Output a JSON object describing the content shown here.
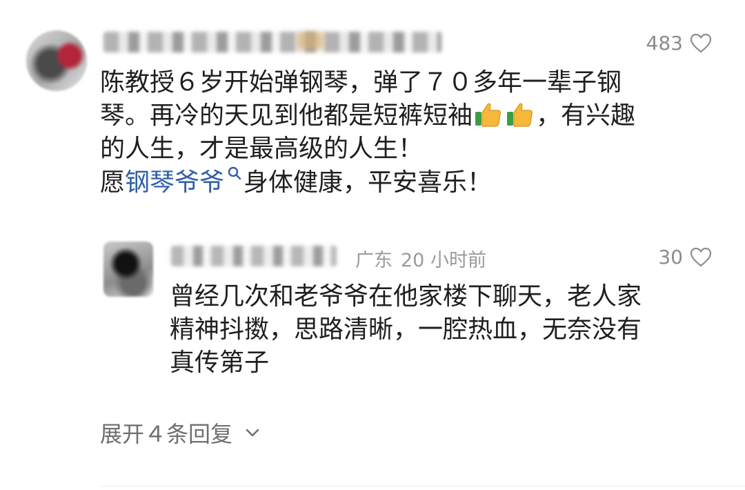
{
  "comment": {
    "like_count": "483",
    "line1": "陈教授６岁开始弹钢琴，弹了７０多年一辈子钢",
    "line2_a": "琴。再冷的天见到他都是短裤短袖",
    "line2_b": "，有兴趣",
    "line3": "的人生，才是最高级的人生！",
    "line4_a": "愿",
    "line4_link": "钢琴爷爷",
    "line4_b": "身体健康，平安喜乐！"
  },
  "reply": {
    "region": "广东",
    "time": "20 小时前",
    "like_count": "30",
    "line1": "曾经几次和老爷爷在他家楼下聊天，老人家",
    "line2": "精神抖擞，思路清晰，一腔热血，无奈没有",
    "line3": "真传第子"
  },
  "expand_replies": "展开４条回复",
  "icons": {
    "like": "heart-outline-icon",
    "emoji": "thumbs-up-emoji-icon",
    "link_search": "search-icon",
    "expand": "chevron-down-icon"
  },
  "colors": {
    "link": "#2f5fa8",
    "meta": "#9a9a9a",
    "expand": "#6e6e6e"
  }
}
